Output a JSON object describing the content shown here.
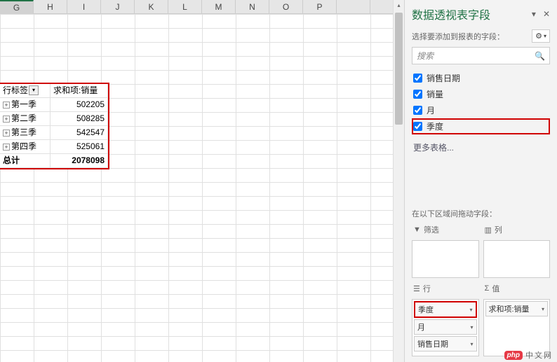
{
  "columns": [
    "G",
    "H",
    "I",
    "J",
    "K",
    "L",
    "M",
    "N",
    "O",
    "P"
  ],
  "selected_col": "G",
  "pivot": {
    "row_header": "行标签",
    "value_header": "求和项:销量",
    "rows": [
      {
        "label": "第一季",
        "value": "502205"
      },
      {
        "label": "第二季",
        "value": "508285"
      },
      {
        "label": "第三季",
        "value": "542547"
      },
      {
        "label": "第四季",
        "value": "525061"
      }
    ],
    "total_label": "总计",
    "total_value": "2078098"
  },
  "pane": {
    "title": "数据透视表字段",
    "subtitle": "选择要添加到报表的字段：",
    "search_placeholder": "搜索",
    "fields": [
      {
        "label": "销售日期",
        "checked": true,
        "highlight": false
      },
      {
        "label": "销量",
        "checked": true,
        "highlight": false
      },
      {
        "label": "月",
        "checked": true,
        "highlight": false
      },
      {
        "label": "季度",
        "checked": true,
        "highlight": true
      }
    ],
    "more_tables": "更多表格...",
    "areas_label": "在以下区域间拖动字段：",
    "filter_title": "筛选",
    "columns_title": "列",
    "rows_title": "行",
    "values_title": "值",
    "row_items": [
      "季度",
      "月",
      "销售日期"
    ],
    "value_items": [
      "求和项:销量"
    ]
  },
  "watermark": {
    "logo": "php",
    "text": "中文网"
  }
}
